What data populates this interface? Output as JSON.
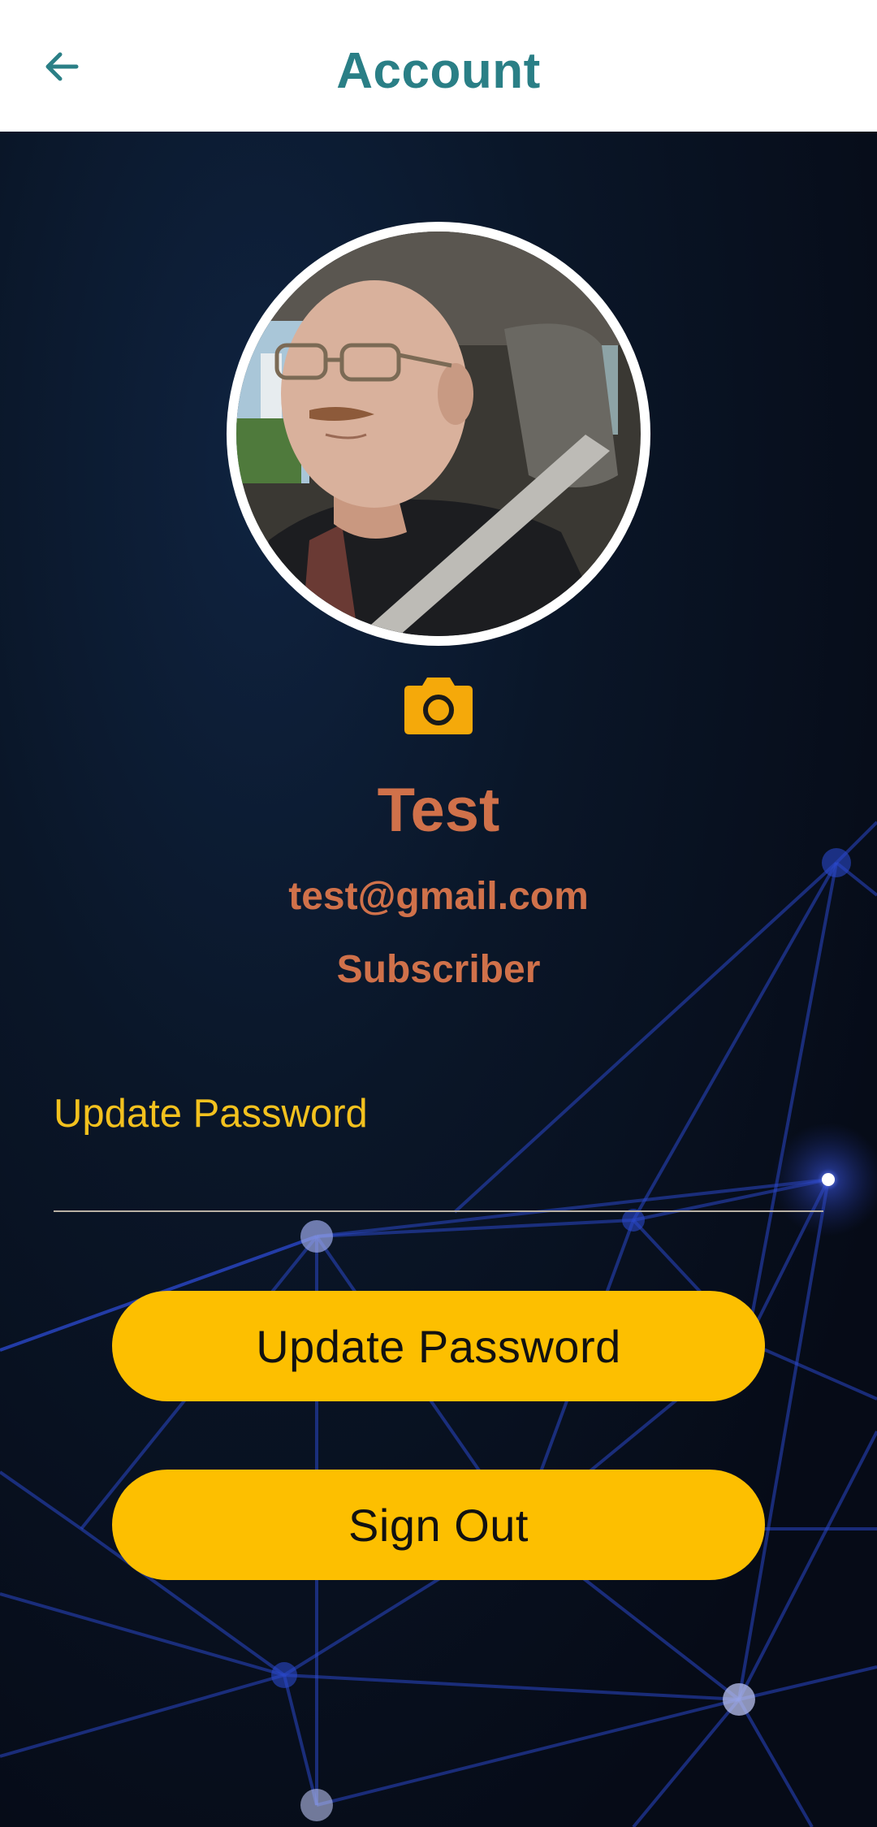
{
  "header": {
    "title": "Account",
    "back_icon": "arrow-left-icon",
    "title_color": "#2a7f86"
  },
  "profile": {
    "camera_icon": "camera-icon",
    "name": "Test",
    "email": "test@gmail.com",
    "role": "Subscriber",
    "text_color": "#d0714a"
  },
  "password_form": {
    "label": "Update Password",
    "value": "",
    "label_color": "#f3c11e"
  },
  "actions": {
    "update_password_label": "Update Password",
    "sign_out_label": "Sign Out",
    "button_color": "#fdbf00"
  },
  "theme": {
    "background": "#070d1a",
    "network_color": "#2a47c9"
  }
}
